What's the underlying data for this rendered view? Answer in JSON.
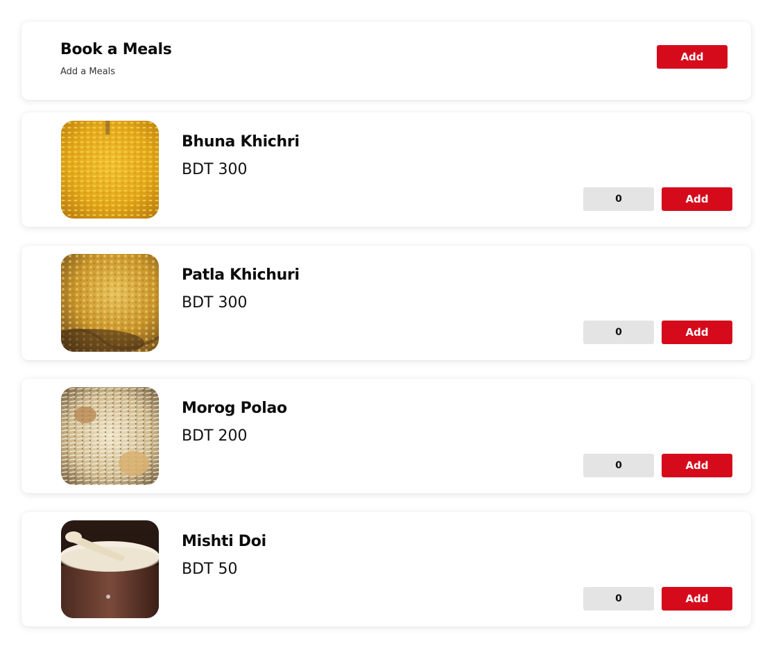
{
  "header": {
    "title": "Book a Meals",
    "subtitle": "Add a Meals",
    "add_label": "Add"
  },
  "meals": [
    {
      "name": "Bhuna Khichri",
      "price": "BDT 300",
      "quantity": "0",
      "add_label": "Add",
      "image": "bhuna-khichri-photo"
    },
    {
      "name": "Patla Khichuri",
      "price": "BDT 300",
      "quantity": "0",
      "add_label": "Add",
      "image": "patla-khichuri-photo"
    },
    {
      "name": "Morog Polao",
      "price": "BDT 200",
      "quantity": "0",
      "add_label": "Add",
      "image": "morog-polao-photo"
    },
    {
      "name": "Mishti Doi",
      "price": "BDT 50",
      "quantity": "0",
      "add_label": "Add",
      "image": "mishti-doi-photo"
    }
  ],
  "colors": {
    "accent": "#d50b1c",
    "quantity_bg": "#e4e4e4"
  }
}
